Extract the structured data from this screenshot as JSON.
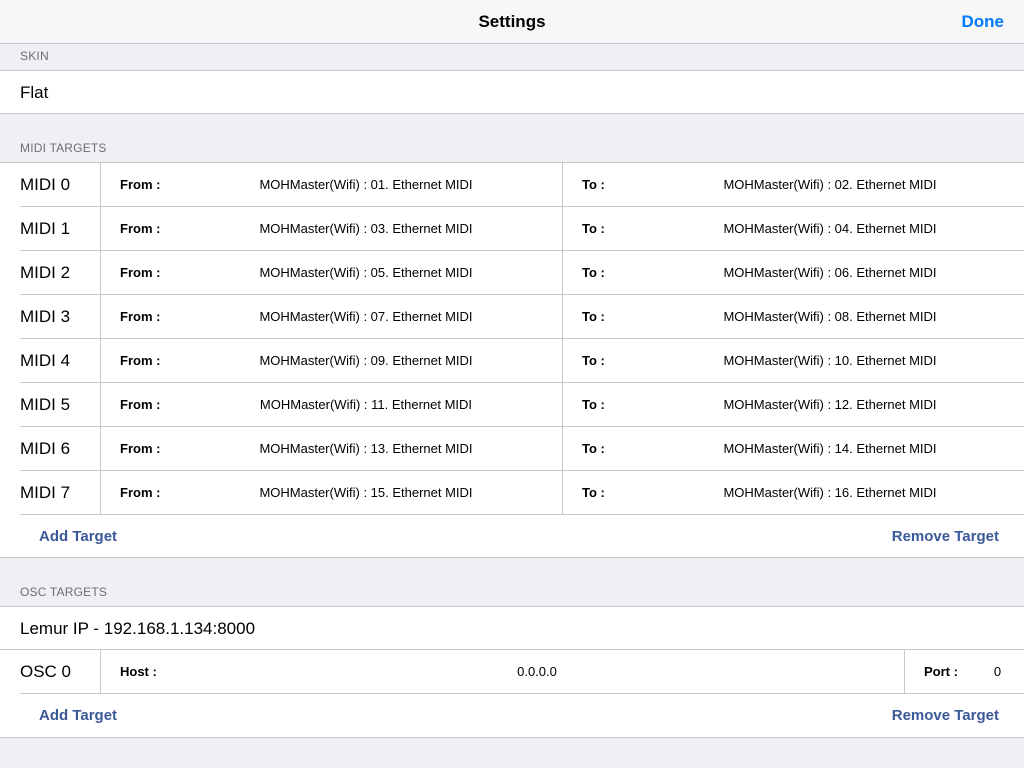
{
  "navbar": {
    "title": "Settings",
    "done_label": "Done"
  },
  "skin": {
    "header": "SKIN",
    "value": "Flat"
  },
  "midi": {
    "header": "MIDI TARGETS",
    "from_label": "From :",
    "to_label": "To :",
    "rows": [
      {
        "name": "MIDI 0",
        "from": "MOHMaster(Wifi) : 01. Ethernet MIDI",
        "to": "MOHMaster(Wifi) : 02. Ethernet MIDI"
      },
      {
        "name": "MIDI 1",
        "from": "MOHMaster(Wifi) : 03. Ethernet MIDI",
        "to": "MOHMaster(Wifi) : 04. Ethernet MIDI"
      },
      {
        "name": "MIDI 2",
        "from": "MOHMaster(Wifi) : 05. Ethernet MIDI",
        "to": "MOHMaster(Wifi) : 06. Ethernet MIDI"
      },
      {
        "name": "MIDI 3",
        "from": "MOHMaster(Wifi) : 07. Ethernet MIDI",
        "to": "MOHMaster(Wifi) : 08. Ethernet MIDI"
      },
      {
        "name": "MIDI 4",
        "from": "MOHMaster(Wifi) : 09. Ethernet MIDI",
        "to": "MOHMaster(Wifi) : 10. Ethernet MIDI"
      },
      {
        "name": "MIDI 5",
        "from": "MOHMaster(Wifi) : 11. Ethernet MIDI",
        "to": "MOHMaster(Wifi) : 12. Ethernet MIDI"
      },
      {
        "name": "MIDI 6",
        "from": "MOHMaster(Wifi) : 13. Ethernet MIDI",
        "to": "MOHMaster(Wifi) : 14. Ethernet MIDI"
      },
      {
        "name": "MIDI 7",
        "from": "MOHMaster(Wifi) : 15. Ethernet MIDI",
        "to": "MOHMaster(Wifi) : 16. Ethernet MIDI"
      }
    ],
    "add_label": "Add Target",
    "remove_label": "Remove Target"
  },
  "osc": {
    "header": "OSC TARGETS",
    "lemur_ip": "Lemur IP - 192.168.1.134:8000",
    "rows": [
      {
        "name": "OSC 0",
        "host_label": "Host :",
        "host": "0.0.0.0",
        "port_label": "Port :",
        "port": "0"
      }
    ],
    "add_label": "Add Target",
    "remove_label": "Remove Target"
  },
  "colors": {
    "accent": "#007aff",
    "action": "#3b5998",
    "background": "#efeff4",
    "separator": "#c8c7cc"
  }
}
